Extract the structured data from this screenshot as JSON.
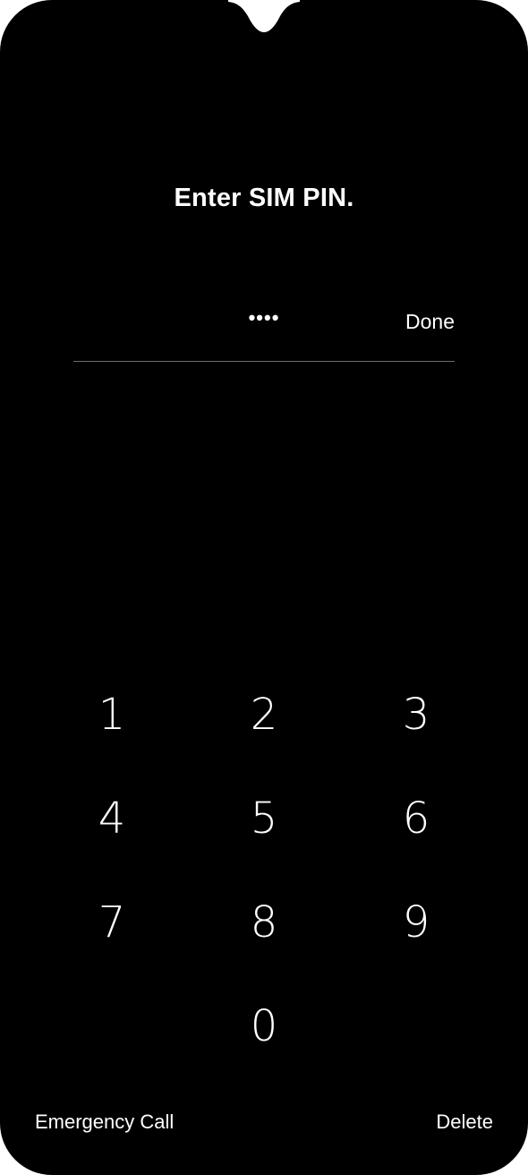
{
  "screen": {
    "title": "Enter SIM PIN.",
    "background_color": "#000000",
    "text_color": "#ffffff"
  },
  "pin_field": {
    "masked_value": "••••",
    "done_label": "Done"
  },
  "keypad": {
    "keys": [
      "1",
      "2",
      "3",
      "4",
      "5",
      "6",
      "7",
      "8",
      "9",
      "0"
    ]
  },
  "footer": {
    "emergency_call_label": "Emergency Call",
    "delete_label": "Delete"
  }
}
